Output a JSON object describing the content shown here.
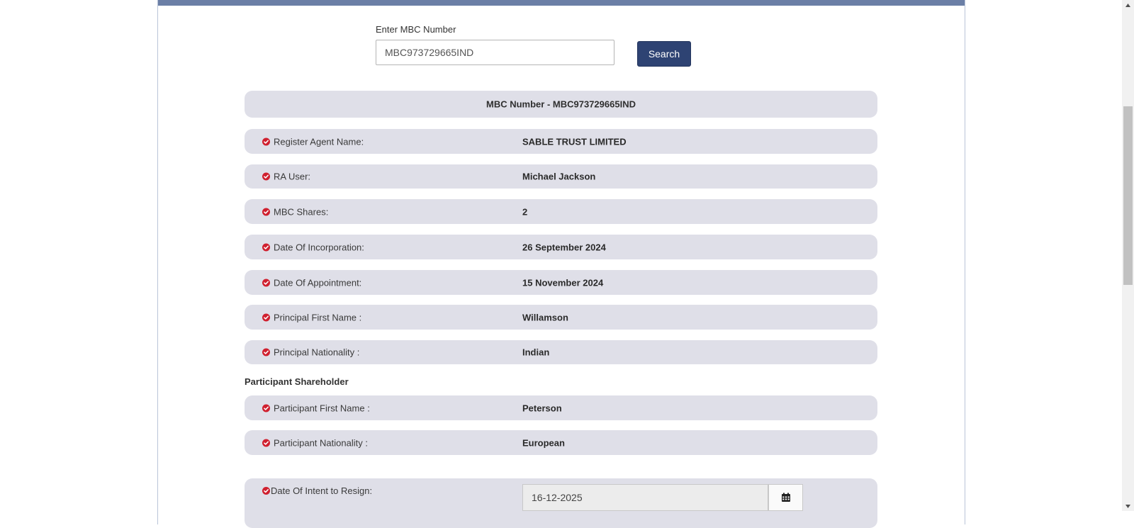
{
  "search": {
    "label": "Enter MBC Number",
    "value": "MBC973729665IND",
    "button_label": "Search"
  },
  "title": "MBC Number - MBC973729665IND",
  "details": [
    {
      "key": "Register Agent Name:",
      "value": "SABLE TRUST LIMITED"
    },
    {
      "key": "RA User:",
      "value": "Michael Jackson"
    },
    {
      "key": "MBC Shares:",
      "value": "2"
    },
    {
      "key": "Date Of Incorporation:",
      "value": "26 September 2024"
    },
    {
      "key": "Date Of Appointment:",
      "value": "15 November 2024"
    },
    {
      "key": "Principal First Name :",
      "value": "Willamson"
    },
    {
      "key": "Principal Nationality :",
      "value": "Indian"
    }
  ],
  "participant": {
    "section_title": "Participant Shareholder",
    "rows": [
      {
        "key": "Participant First Name :",
        "value": "Peterson"
      },
      {
        "key": "Participant Nationality :",
        "value": "European"
      }
    ]
  },
  "resign": {
    "label": "Date Of Intent to Resign:",
    "date_value": "16-12-2025"
  },
  "colors": {
    "accent": "#2e4373",
    "header_bar": "#6b7fa6",
    "row_bg": "#dfdfe8",
    "check_icon": "#d0202f"
  },
  "icons": {
    "check": "check-circle-icon",
    "calendar": "calendar-icon"
  }
}
